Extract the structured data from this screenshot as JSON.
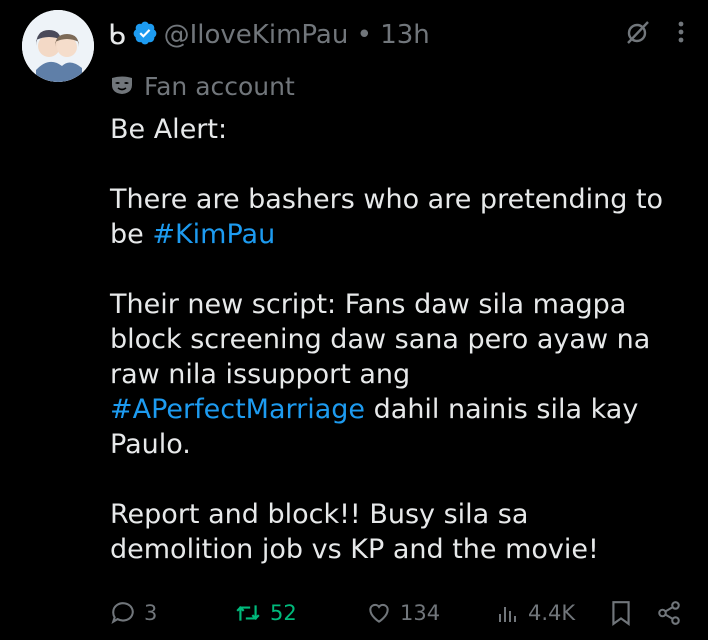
{
  "tweet": {
    "display_name": "ᑲ",
    "handle": "@IloveKimPau",
    "separator": "•",
    "time": "13h",
    "label_text": "Fan account",
    "lines": {
      "l1": "Be Alert:",
      "l2": "There are bashers who are pretending to",
      "l3_text": "be ",
      "l3_tag": "#KimPau",
      "l4": "Their new script: Fans daw sila magpa",
      "l5": "block screening daw sana pero ayaw na",
      "l6": "raw nila issupport ang",
      "l7_tag": "#APerfectMarriage",
      "l7_text": " dahil nainis sila kay",
      "l8": "Paulo.",
      "l9": "Report and block!! Busy sila sa",
      "l10": "demolition job vs KP and the movie!"
    }
  },
  "actions": {
    "replies": "3",
    "reposts": "52",
    "likes": "134",
    "views": "4.4K"
  },
  "colors": {
    "background": "#000000",
    "text": "#e7e9ea",
    "muted": "#71767b",
    "link": "#1d9bf0",
    "repost_active": "#00ba7c",
    "verified": "#1d9bf0"
  },
  "icons": [
    "avatar",
    "verified-badge-icon",
    "grok-icon",
    "more-icon",
    "fan-account-mask-icon",
    "reply-icon",
    "repost-icon",
    "like-icon",
    "views-icon",
    "bookmark-icon",
    "share-icon"
  ]
}
